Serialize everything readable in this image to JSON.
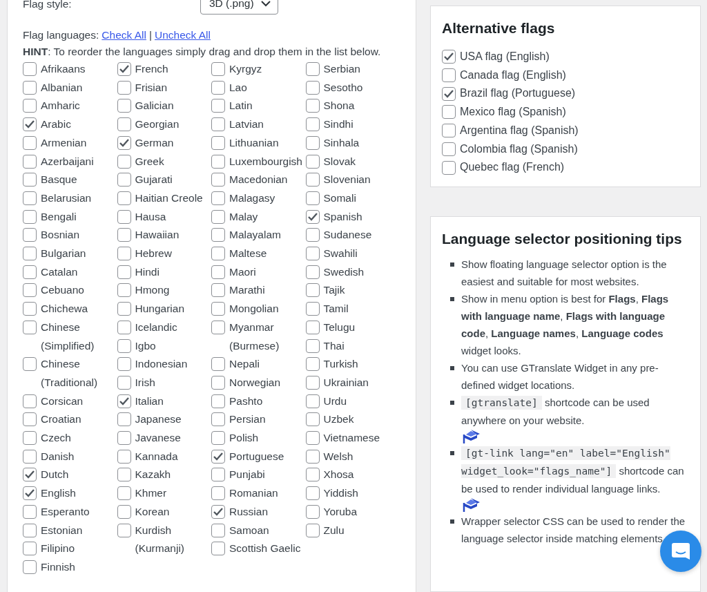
{
  "flag_style": {
    "label": "Flag style:",
    "value": "3D (.png)"
  },
  "flag_languages": {
    "label": "Flag languages:",
    "check_all": "Check All",
    "separator": "|",
    "uncheck_all": "Uncheck All",
    "hint": "**HINT**: To reorder the languages simply drag and drop them in the list below."
  },
  "language_columns": [
    [
      {
        "name": "Afrikaans",
        "checked": false
      },
      {
        "name": "Albanian",
        "checked": false
      },
      {
        "name": "Amharic",
        "checked": false
      },
      {
        "name": "Arabic",
        "checked": true
      },
      {
        "name": "Armenian",
        "checked": false
      },
      {
        "name": "Azerbaijani",
        "checked": false
      },
      {
        "name": "Basque",
        "checked": false
      },
      {
        "name": "Belarusian",
        "checked": false
      },
      {
        "name": "Bengali",
        "checked": false
      },
      {
        "name": "Bosnian",
        "checked": false
      },
      {
        "name": "Bulgarian",
        "checked": false
      },
      {
        "name": "Catalan",
        "checked": false
      },
      {
        "name": "Cebuano",
        "checked": false
      },
      {
        "name": "Chichewa",
        "checked": false
      },
      {
        "name": "Chinese (Simplified)",
        "checked": false
      },
      {
        "name": "Chinese (Traditional)",
        "checked": false
      },
      {
        "name": "Corsican",
        "checked": false
      },
      {
        "name": "Croatian",
        "checked": false
      },
      {
        "name": "Czech",
        "checked": false
      },
      {
        "name": "Danish",
        "checked": false
      },
      {
        "name": "Dutch",
        "checked": true
      },
      {
        "name": "English",
        "checked": true
      },
      {
        "name": "Esperanto",
        "checked": false
      },
      {
        "name": "Estonian",
        "checked": false
      },
      {
        "name": "Filipino",
        "checked": false
      },
      {
        "name": "Finnish",
        "checked": false
      }
    ],
    [
      {
        "name": "French",
        "checked": true
      },
      {
        "name": "Frisian",
        "checked": false
      },
      {
        "name": "Galician",
        "checked": false
      },
      {
        "name": "Georgian",
        "checked": false
      },
      {
        "name": "German",
        "checked": true
      },
      {
        "name": "Greek",
        "checked": false
      },
      {
        "name": "Gujarati",
        "checked": false
      },
      {
        "name": "Haitian Creole",
        "checked": false
      },
      {
        "name": "Hausa",
        "checked": false
      },
      {
        "name": "Hawaiian",
        "checked": false
      },
      {
        "name": "Hebrew",
        "checked": false
      },
      {
        "name": "Hindi",
        "checked": false
      },
      {
        "name": "Hmong",
        "checked": false
      },
      {
        "name": "Hungarian",
        "checked": false
      },
      {
        "name": "Icelandic",
        "checked": false
      },
      {
        "name": "Igbo",
        "checked": false
      },
      {
        "name": "Indonesian",
        "checked": false
      },
      {
        "name": "Irish",
        "checked": false
      },
      {
        "name": "Italian",
        "checked": true
      },
      {
        "name": "Japanese",
        "checked": false
      },
      {
        "name": "Javanese",
        "checked": false
      },
      {
        "name": "Kannada",
        "checked": false
      },
      {
        "name": "Kazakh",
        "checked": false
      },
      {
        "name": "Khmer",
        "checked": false
      },
      {
        "name": "Korean",
        "checked": false
      },
      {
        "name": "Kurdish (Kurmanji)",
        "checked": false
      }
    ],
    [
      {
        "name": "Kyrgyz",
        "checked": false
      },
      {
        "name": "Lao",
        "checked": false
      },
      {
        "name": "Latin",
        "checked": false
      },
      {
        "name": "Latvian",
        "checked": false
      },
      {
        "name": "Lithuanian",
        "checked": false
      },
      {
        "name": "Luxembourgish",
        "checked": false
      },
      {
        "name": "Macedonian",
        "checked": false
      },
      {
        "name": "Malagasy",
        "checked": false
      },
      {
        "name": "Malay",
        "checked": false
      },
      {
        "name": "Malayalam",
        "checked": false
      },
      {
        "name": "Maltese",
        "checked": false
      },
      {
        "name": "Maori",
        "checked": false
      },
      {
        "name": "Marathi",
        "checked": false
      },
      {
        "name": "Mongolian",
        "checked": false
      },
      {
        "name": "Myanmar (Burmese)",
        "checked": false
      },
      {
        "name": "Nepali",
        "checked": false
      },
      {
        "name": "Norwegian",
        "checked": false
      },
      {
        "name": "Pashto",
        "checked": false
      },
      {
        "name": "Persian",
        "checked": false
      },
      {
        "name": "Polish",
        "checked": false
      },
      {
        "name": "Portuguese",
        "checked": true
      },
      {
        "name": "Punjabi",
        "checked": false
      },
      {
        "name": "Romanian",
        "checked": false
      },
      {
        "name": "Russian",
        "checked": true
      },
      {
        "name": "Samoan",
        "checked": false
      },
      {
        "name": "Scottish Gaelic",
        "checked": false
      }
    ],
    [
      {
        "name": "Serbian",
        "checked": false
      },
      {
        "name": "Sesotho",
        "checked": false
      },
      {
        "name": "Shona",
        "checked": false
      },
      {
        "name": "Sindhi",
        "checked": false
      },
      {
        "name": "Sinhala",
        "checked": false
      },
      {
        "name": "Slovak",
        "checked": false
      },
      {
        "name": "Slovenian",
        "checked": false
      },
      {
        "name": "Somali",
        "checked": false
      },
      {
        "name": "Spanish",
        "checked": true
      },
      {
        "name": "Sudanese",
        "checked": false
      },
      {
        "name": "Swahili",
        "checked": false
      },
      {
        "name": "Swedish",
        "checked": false
      },
      {
        "name": "Tajik",
        "checked": false
      },
      {
        "name": "Tamil",
        "checked": false
      },
      {
        "name": "Telugu",
        "checked": false
      },
      {
        "name": "Thai",
        "checked": false
      },
      {
        "name": "Turkish",
        "checked": false
      },
      {
        "name": "Ukrainian",
        "checked": false
      },
      {
        "name": "Urdu",
        "checked": false
      },
      {
        "name": "Uzbek",
        "checked": false
      },
      {
        "name": "Vietnamese",
        "checked": false
      },
      {
        "name": "Welsh",
        "checked": false
      },
      {
        "name": "Xhosa",
        "checked": false
      },
      {
        "name": "Yiddish",
        "checked": false
      },
      {
        "name": "Yoruba",
        "checked": false
      },
      {
        "name": "Zulu",
        "checked": false
      }
    ]
  ],
  "alternative_flags": {
    "title": "Alternative flags",
    "items": [
      {
        "label": "USA flag (English)",
        "checked": true
      },
      {
        "label": "Canada flag (English)",
        "checked": false
      },
      {
        "label": "Brazil flag (Portuguese)",
        "checked": true
      },
      {
        "label": "Mexico flag (Spanish)",
        "checked": false
      },
      {
        "label": "Argentina flag (Spanish)",
        "checked": false
      },
      {
        "label": "Colombia flag (Spanish)",
        "checked": false
      },
      {
        "label": "Quebec flag (French)",
        "checked": false
      }
    ]
  },
  "positioning_tips": {
    "title": "Language selector positioning tips",
    "items": [
      {
        "segments": [
          {
            "kind": "text",
            "text": "Show floating language selector option is the easiest and suitable for most websites."
          }
        ],
        "tutorial_icon": false
      },
      {
        "segments": [
          {
            "kind": "text",
            "text": "Show in menu option is best for **Flags**, **Flags with language name**, **Flags with language code**, **Language names**, **Language codes** widget looks."
          }
        ],
        "tutorial_icon": false
      },
      {
        "segments": [
          {
            "kind": "text",
            "text": "You can use GTranslate Widget in any pre-defined widget locations."
          }
        ],
        "tutorial_icon": false
      },
      {
        "segments": [
          {
            "kind": "code",
            "text": "[gtranslate]"
          },
          {
            "kind": "text",
            "text": "shortcode can be used anywhere on your website."
          }
        ],
        "tutorial_icon": true
      },
      {
        "segments": [
          {
            "kind": "code",
            "text": "[gt-link lang=\"en\" label=\"English\" widget_look=\"flags_name\"]"
          },
          {
            "kind": "text",
            "text": "shortcode can be used to render individual language links."
          }
        ],
        "tutorial_icon": true
      },
      {
        "segments": [
          {
            "kind": "text",
            "text": "Wrapper selector CSS can be used to render the language selector inside matching elements."
          }
        ],
        "tutorial_icon": false
      }
    ]
  }
}
